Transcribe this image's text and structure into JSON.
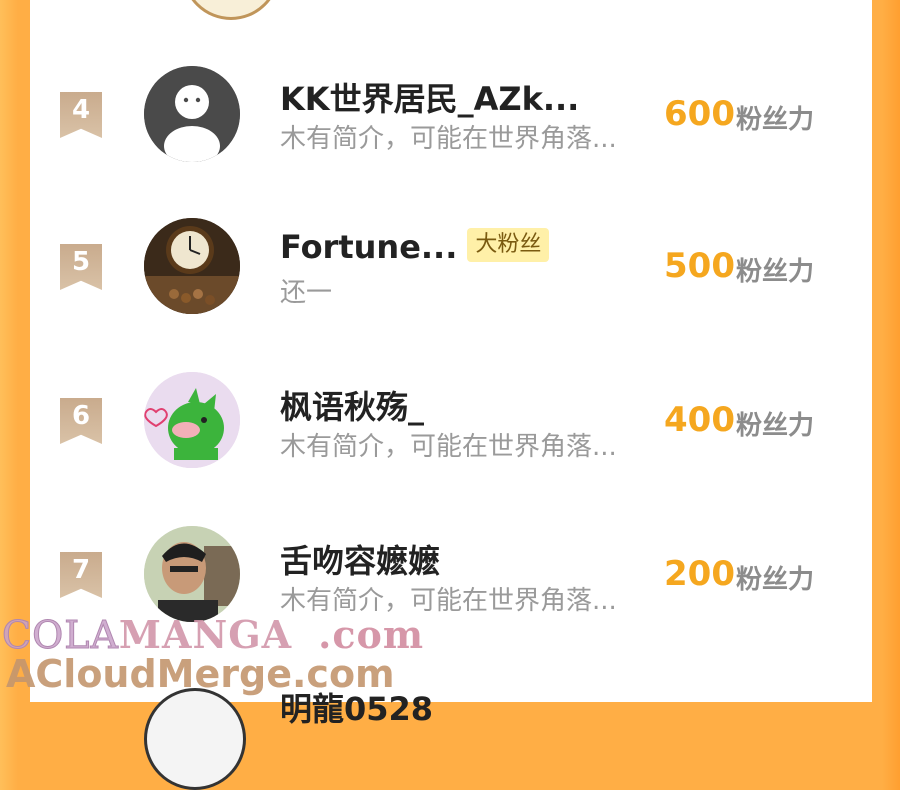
{
  "rows": [
    {
      "rank": "4",
      "name": "KK世界居民_AZk...",
      "tag": "",
      "bio": "木有简介，可能在世界角落...",
      "score": "600",
      "unit": "粉丝力",
      "avatar_icon": "default-user-icon"
    },
    {
      "rank": "5",
      "name": "Fortune...",
      "tag": "大粉丝",
      "bio": "还一",
      "score": "500",
      "unit": "粉丝力",
      "avatar_icon": "clock-photo"
    },
    {
      "rank": "6",
      "name": "枫语秋殇_",
      "tag": "",
      "bio": "木有简介，可能在世界角落...",
      "score": "400",
      "unit": "粉丝力",
      "avatar_icon": "green-dinosaur"
    },
    {
      "rank": "7",
      "name": "舌吻容嬷嬷",
      "tag": "",
      "bio": "木有简介，可能在世界角落...",
      "score": "200",
      "unit": "粉丝力",
      "avatar_icon": "man-photo"
    }
  ],
  "partial_next": {
    "name": "明龍0528"
  },
  "watermark": {
    "line1_a": "COLA",
    "line1_b": "MANGA",
    "line1_c": ".com",
    "line2": "ACloudMerge.com"
  },
  "colors": {
    "score": "#f5a71f",
    "badge": "#c9ab8d",
    "border": "#ffae45",
    "tag_bg": "#fff0a8"
  }
}
